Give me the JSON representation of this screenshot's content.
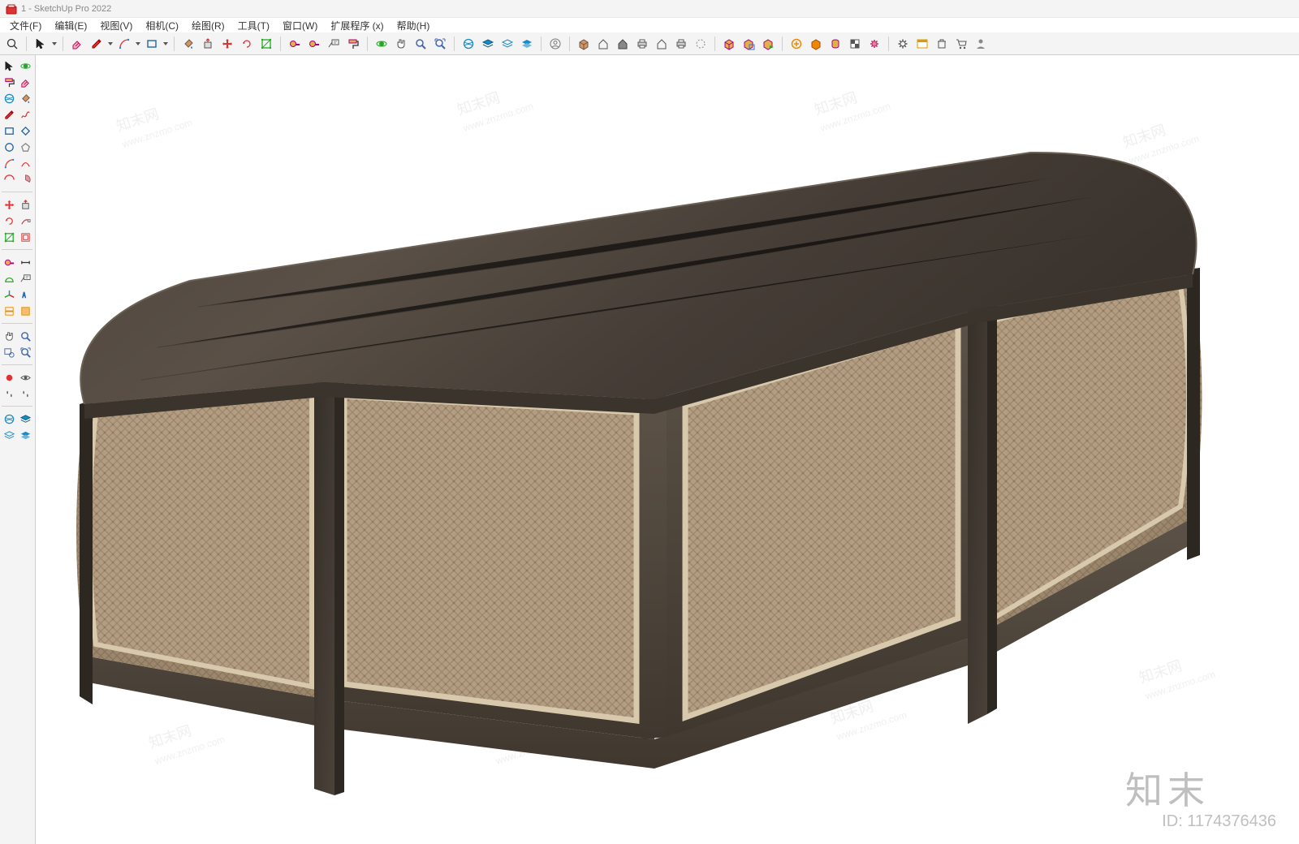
{
  "window": {
    "title": "1 - SketchUp Pro 2022"
  },
  "menu": {
    "items": [
      "文件(F)",
      "编辑(E)",
      "视图(V)",
      "相机(C)",
      "绘图(R)",
      "工具(T)",
      "窗口(W)",
      "扩展程序 (x)",
      "帮助(H)"
    ]
  },
  "top_toolbar": {
    "groups": [
      [
        "search-icon"
      ],
      [
        "select-arrow-icon",
        "dropdown"
      ],
      [
        "eraser-icon",
        "pencil-icon",
        "dropdown",
        "arc-icon",
        "dropdown",
        "rectangle-icon",
        "dropdown"
      ],
      [
        "paint-bucket-icon",
        "push-pull-icon",
        "move-quad-icon",
        "rotate-quad-icon",
        "scale-icon"
      ],
      [
        "tape-icon",
        "tape-icon",
        "text-label-icon",
        "paint-roller-icon"
      ],
      [
        "orbit-icon",
        "pan-icon",
        "zoom-icon",
        "zoom-extents-icon"
      ],
      [
        "globe-swirl-icon",
        "layers-icon",
        "layers-outline-icon",
        "layers-blue-icon"
      ],
      [
        "user-circle-icon"
      ],
      [
        "box-icon",
        "house-outline-icon",
        "house-fill-icon",
        "printer-icon",
        "house-outline-icon",
        "printer-icon",
        "circle-dashed-icon"
      ],
      [
        "cube-yellow-icon",
        "cube-select-icon",
        "cube-run-icon"
      ],
      [
        "plus-circle-icon",
        "cube-orange-icon",
        "cylinder-icon",
        "checker-icon",
        "gear-pink-icon"
      ],
      [
        "gear-icon",
        "window-icon",
        "trash-icon",
        "cart-icon",
        "user-silhouette-icon"
      ]
    ]
  },
  "left_toolbar": {
    "groups": [
      [
        "select-arrow-icon",
        "orbit-icon"
      ],
      [
        "paint-roller-icon",
        "eraser-icon"
      ],
      [
        "globe-swirl-icon",
        "paint-bucket-icon"
      ],
      [
        "pencil-icon",
        "freehand-icon"
      ],
      [
        "rectangle-icon",
        "rectangle-rot-icon"
      ],
      [
        "circle-icon",
        "pentagon-icon"
      ],
      [
        "arc-icon",
        "arc2-icon"
      ],
      [
        "arc3-icon",
        "pie-icon"
      ],
      "divider",
      [
        "move-quad-icon",
        "push-pull-icon"
      ],
      [
        "rotate-quad-icon",
        "follow-me-icon"
      ],
      [
        "scale-icon",
        "offset-icon"
      ],
      "divider",
      [
        "tape-icon",
        "dimension-icon"
      ],
      [
        "protractor-icon",
        "text-label-icon"
      ],
      [
        "axes-icon",
        "text3d-icon"
      ],
      [
        "section-icon",
        "section-fill-icon"
      ],
      "divider",
      [
        "pan-icon",
        "zoom-icon"
      ],
      [
        "zoom-window-icon",
        "zoom-extents-icon"
      ],
      "divider",
      [
        "record-icon",
        "orbit-eye-icon"
      ],
      [
        "footprints-icon",
        "footprints-icon"
      ],
      "divider",
      [
        "globe-swirl-icon",
        "layers-icon"
      ],
      [
        "layers-outline-icon",
        "layers-blue-icon"
      ]
    ]
  },
  "watermark": {
    "brand": "知末网",
    "url": "www.znzmo.com",
    "logo_text": "知末",
    "id_label": "ID: 1174376436"
  }
}
